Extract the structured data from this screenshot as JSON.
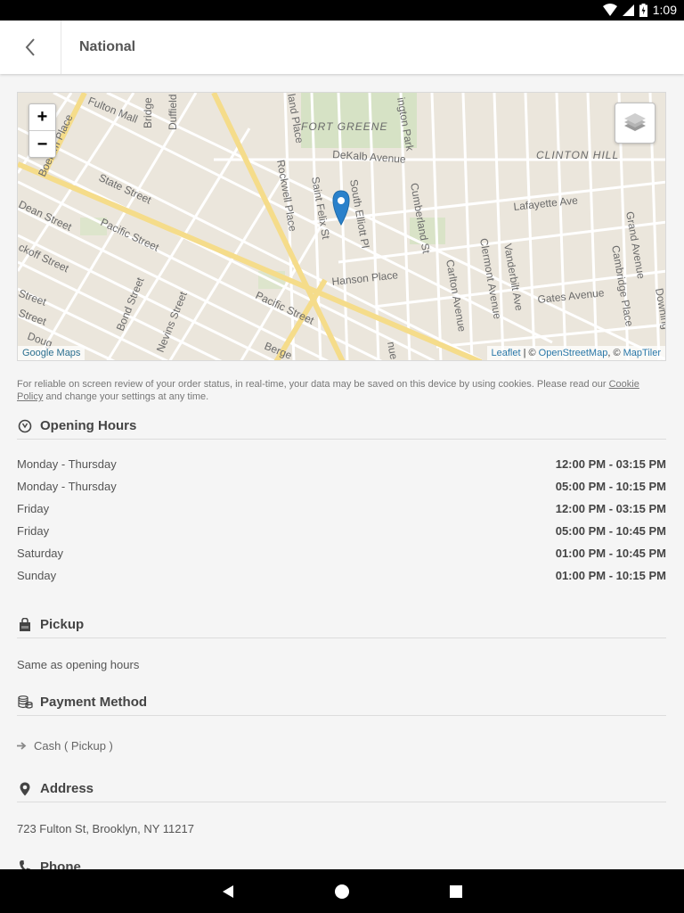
{
  "status_bar": {
    "time": "1:09",
    "icons": [
      "wifi-icon",
      "signal-icon",
      "battery-charging-icon"
    ]
  },
  "app_bar": {
    "title": "National",
    "back_icon": "chevron-left-icon"
  },
  "map": {
    "zoom_in_label": "+",
    "zoom_out_label": "−",
    "layers_icon": "layers-icon",
    "marker_color": "#2a81cb",
    "google_maps_label": "Google Maps",
    "attribution": {
      "leaflet": "Leaflet",
      "separator": " | © ",
      "osm": "OpenStreetMap",
      "comma": ", © ",
      "maptiler": "MapTiler"
    },
    "labels": {
      "fort_greene": "FORT GREENE",
      "clinton_hill": "CLINTON HILL",
      "fulton_mall": "Fulton Mall",
      "bridge": "Bridge",
      "duffield": "Duffield",
      "boerum_place": "Boerum Place",
      "state_street": "State Street",
      "dean_street": "Dean Street",
      "pacific_street_w": "Pacific Street",
      "wyckoff_street": "ckoff Street",
      "street_1": "Street",
      "street_2": "Street",
      "douglass": "Doug",
      "bond_street": "Bond Street",
      "nevins_street": "Nevins Street",
      "pacific_street_e": "Pacific Street",
      "bergen": "Berge",
      "ashland_place": "land Place",
      "rockwell_place": "Rockwell Place",
      "dekalb": "DeKalb Avenue",
      "saint_felix": "Saint Felix St",
      "south_elliott": "South Elliott Pl",
      "washington_park": "ington Park",
      "cumberland": "Cumberland St",
      "hanson_place": "Hanson Place",
      "carlton": "Carlton Avenue",
      "clermont": "Clermont Avenue",
      "vanderbilt": "Vanderbilt Ave",
      "lafayette": "Lafayette Ave",
      "gates": "Gates Avenue",
      "grand": "Grand Avenue",
      "cambridge": "Cambridge Place",
      "downing": "Downing",
      "flatbush": "nue"
    }
  },
  "cookie_notice": {
    "text_before": "For reliable on screen review of your order status, in real-time, your data may be saved on this device by using cookies. Please read our ",
    "link": "Cookie Policy",
    "text_after": " and change your settings at any time."
  },
  "opening_hours": {
    "title": "Opening Hours",
    "icon": "clock-icon",
    "rows": [
      {
        "day": "Monday - Thursday",
        "time": "12:00 PM - 03:15 PM"
      },
      {
        "day": "Monday - Thursday",
        "time": "05:00 PM - 10:15 PM"
      },
      {
        "day": "Friday",
        "time": "12:00 PM - 03:15 PM"
      },
      {
        "day": "Friday",
        "time": "05:00 PM - 10:45 PM"
      },
      {
        "day": "Saturday",
        "time": "01:00 PM - 10:45 PM"
      },
      {
        "day": "Sunday",
        "time": "01:00 PM - 10:15 PM"
      }
    ]
  },
  "pickup": {
    "title": "Pickup",
    "icon": "shopping-bag-icon",
    "text": "Same as opening hours"
  },
  "payment": {
    "title": "Payment Method",
    "icon": "coins-icon",
    "methods": [
      {
        "icon": "arrow-right-icon",
        "label": "Cash ( Pickup )"
      }
    ]
  },
  "address": {
    "title": "Address",
    "icon": "map-marker-icon",
    "text": "723 Fulton St, Brooklyn, NY 11217"
  },
  "phone": {
    "title": "Phone",
    "icon": "phone-icon"
  },
  "nav_bar": {
    "back": "nav-back-icon",
    "home": "nav-home-icon",
    "recents": "nav-recents-icon"
  }
}
